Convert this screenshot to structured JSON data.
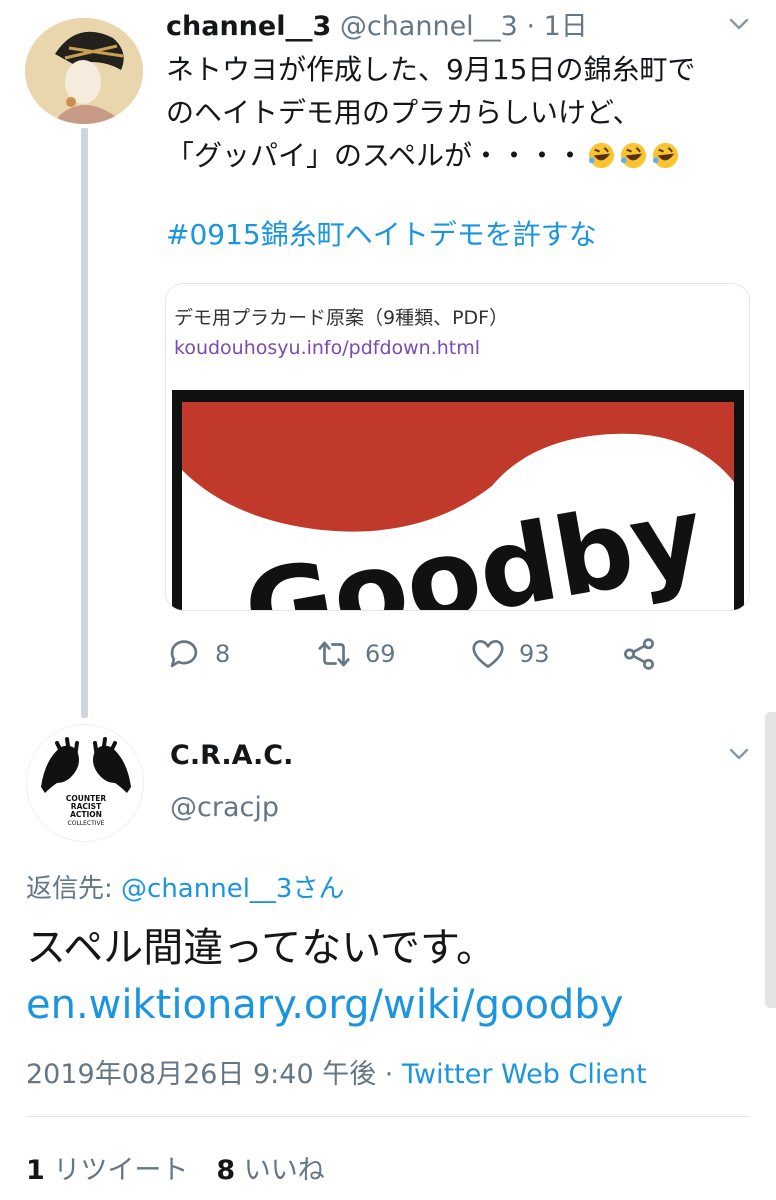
{
  "tweet1": {
    "name": "channel__3",
    "handle": "@channel__3",
    "time": "1日",
    "lines": [
      "ネトウヨが作成した、9月15日の錦糸町で",
      "のヘイトデモ用のプラカらしいけど、",
      "「グッパイ」のスペルが・・・・"
    ],
    "emoji": [
      "rolling-on-floor-laughing",
      "rolling-on-floor-laughing",
      "rolling-on-floor-laughing"
    ],
    "hashtag": "#0915錦糸町ヘイトデモを許すな",
    "card": {
      "title": "デモ用プラカード原案（9種類、PDF）",
      "url": "koudouhosyu.info/pdfdown.html",
      "image_text": "Goodby"
    },
    "actions": {
      "replies": "8",
      "retweets": "69",
      "likes": "93"
    }
  },
  "tweet2": {
    "name": "C.R.A.C.",
    "handle": "@cracjp",
    "avatar_text": [
      "COUNTER",
      "RACIST",
      "ACTION",
      "COLLECTIVE"
    ],
    "reply_prefix": "返信先: ",
    "reply_mention": "@channel__3さん",
    "text": "スペル間違ってないです。",
    "link": "en.wiktionary.org/wiki/goodby",
    "datetime": "2019年08月26日 9:40 午後 · ",
    "client": "Twitter Web Client",
    "retweet_count": "1",
    "retweet_label": "リツイート",
    "like_count": "8",
    "like_label": "いいね"
  },
  "colors": {
    "link_blue": "#1b95e0",
    "secondary_gray": "#657786",
    "card_url_purple": "#7a4ab0",
    "placard_red": "#c0392b"
  }
}
